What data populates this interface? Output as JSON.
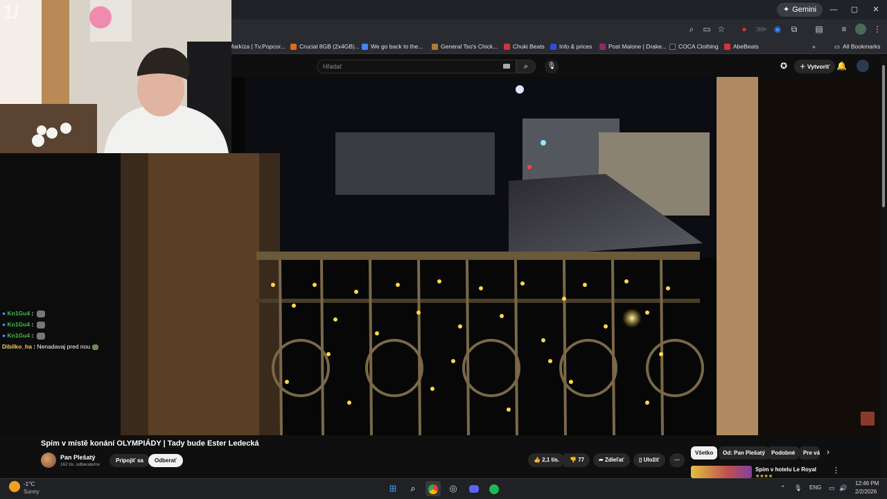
{
  "browser": {
    "gemini_label": "Gemini",
    "window_controls": [
      "—",
      "▢",
      "✕"
    ],
    "bookmarks": [
      {
        "label": "Markíza | Tv.Popcor...",
        "color": "#3b6fd6"
      },
      {
        "label": "Crucial 8GB (2x4GB)...",
        "color": "#e06a1b"
      },
      {
        "label": "We go back to the...",
        "color": "#4285f4"
      },
      {
        "label": "General Tso's Chick...",
        "color": "#b07a3a"
      },
      {
        "label": "Chuki Beats",
        "color": "#d0343a"
      },
      {
        "label": "Info & prices",
        "color": "#2a4fd6"
      },
      {
        "label": "Post Malone | Drake...",
        "color": "#8a2a6a"
      },
      {
        "label": "COCA Clothing",
        "color": "#222222"
      },
      {
        "label": "AbeBeats",
        "color": "#e0303a"
      }
    ],
    "all_bookmarks_label": "All Bookmarks",
    "more_bookmarks": "»"
  },
  "youtube": {
    "search_placeholder": "Hľadať",
    "create_label": "Vytvoriť",
    "video": {
      "title": "Spím v místě konání OLYMPIÁDY | Tady bude Ester Ledecká",
      "channel": "Pan Plešatý",
      "subscribers": "162 tis. odberateľov",
      "join_label": "Pripojiť sa",
      "subscribe_label": "Odberať",
      "likes": "2,1 tis.",
      "dislikes": "77",
      "share_label": "Zdieľať",
      "save_label": "Uložiť",
      "more_label": "⋯"
    },
    "chips": [
      "Všetko",
      "Od: Pan Plešatý",
      "Podobné",
      "Pre vás"
    ],
    "recommended_title": "Spím v hotelu Le Royal"
  },
  "chat": {
    "lines": [
      {
        "user": "Kn1Gu4",
        "message": ""
      },
      {
        "user": "Kn1Gu4",
        "message": ""
      },
      {
        "user": "Kn1Gu4",
        "message": ""
      },
      {
        "user": "Dibilko_ha",
        "message": "Nenadavaj pred nou"
      }
    ]
  },
  "taskbar": {
    "weather_temp": "-1°C",
    "weather_desc": "Sunny",
    "language": "ENG",
    "time": "12:46 PM",
    "date": "2/2/2026"
  },
  "webcam_overlay_text": "1/"
}
